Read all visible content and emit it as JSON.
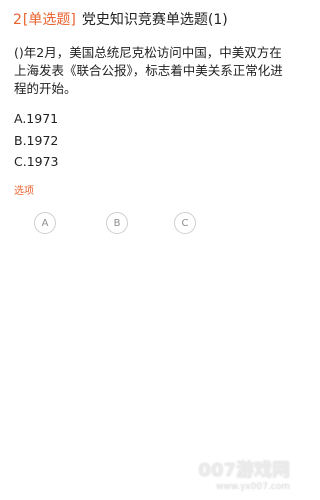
{
  "question": {
    "number": "2",
    "type": "[单选题]",
    "title": "党史知识竞赛单选题(1)",
    "text": "()年2月，美国总统尼克松访问中国，中美双方在上海发表《联合公报》，标志着中美关系正常化进程的开始。"
  },
  "options": [
    {
      "label": "A.1971"
    },
    {
      "label": "B.1972"
    },
    {
      "label": "C.1973"
    }
  ],
  "selection": {
    "label": "选项",
    "choices": [
      "A",
      "B",
      "C"
    ]
  },
  "watermark": {
    "main": "007游戏网",
    "sub": "www.yx007.com"
  },
  "colors": {
    "accent": "#e8632f",
    "text": "#222222",
    "circle_border": "#cfcfcf",
    "circle_text": "#8e8e8e"
  }
}
